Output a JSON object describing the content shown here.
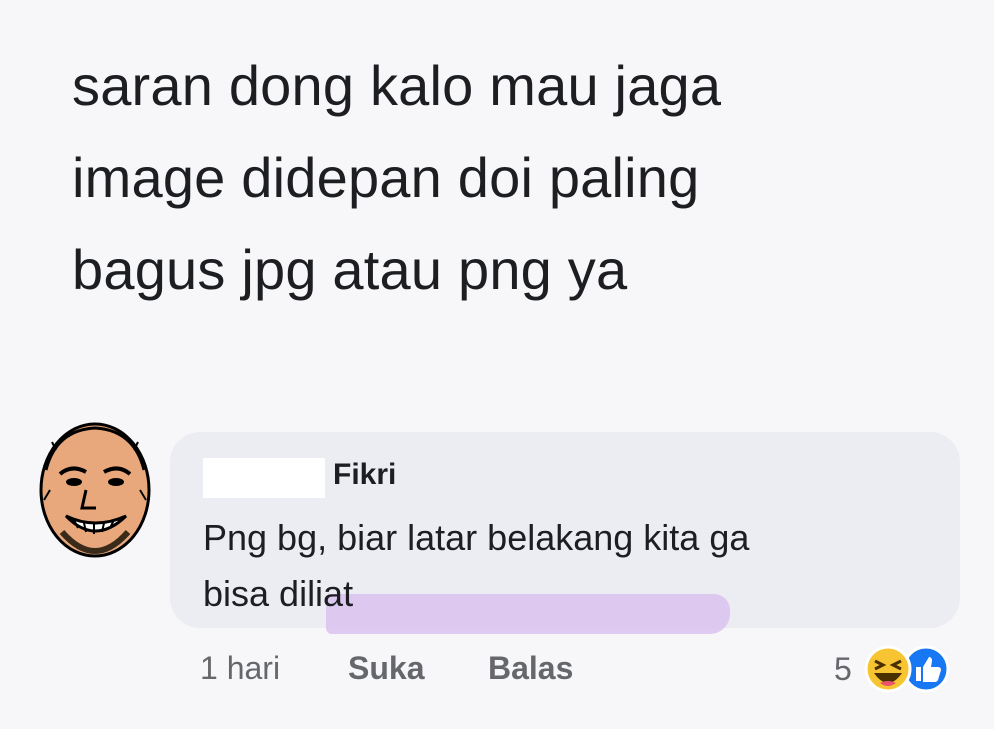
{
  "post": {
    "text": "saran dong kalo mau jaga\nimage didepan doi paling\nbagus jpg atau png ya"
  },
  "comment": {
    "author": "Fikri",
    "text": "Png bg, biar latar belakang kita ga\nbisa diliat",
    "highlight_color": "#dcc4f0",
    "bubble_color": "#ecedf2"
  },
  "actions": {
    "time": "1 hari",
    "like": "Suka",
    "reply": "Balas"
  },
  "reactions": {
    "count": "5",
    "icons": [
      "haha-reaction-icon",
      "like-reaction-icon"
    ]
  }
}
